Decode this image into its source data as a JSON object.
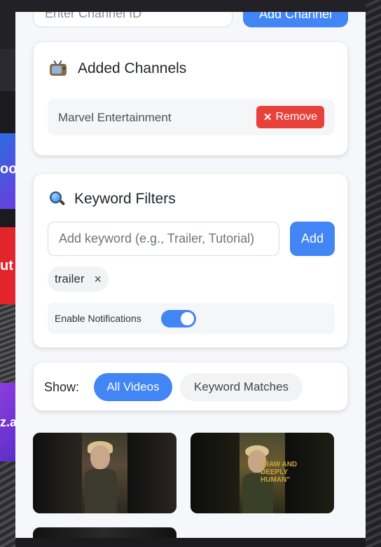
{
  "background": {
    "tile_texts": [
      "ool",
      "ut",
      "z.ar"
    ]
  },
  "channel_form": {
    "input_placeholder": "Enter Channel ID",
    "add_label": "Add Channel"
  },
  "added_channels": {
    "title": "Added Channels",
    "title_icon": "tv-icon",
    "channels": [
      {
        "name": "Marvel Entertainment",
        "remove_label": "Remove"
      }
    ]
  },
  "keyword_filters": {
    "title": "Keyword Filters",
    "title_icon": "magnifier-icon",
    "input_placeholder": "Add keyword (e.g., Trailer, Tutorial)",
    "add_label": "Add",
    "keywords": [
      {
        "label": "trailer",
        "remove_glyph": "×"
      }
    ],
    "notifications": {
      "label": "Enable Notifications",
      "enabled": true
    }
  },
  "show_filter": {
    "label": "Show:",
    "options": [
      {
        "label": "All Videos",
        "active": true
      },
      {
        "label": "Keyword Matches",
        "active": false
      }
    ]
  },
  "videos": [
    {
      "thumbnail_text": ""
    },
    {
      "thumbnail_text": "\"RAW AND\nDEEPLY\nHUMAN\""
    },
    {
      "thumbnail_text": ""
    }
  ],
  "colors": {
    "accent": "#4285f4",
    "danger": "#e8413a",
    "panel_bg": "#f5f7fa"
  }
}
